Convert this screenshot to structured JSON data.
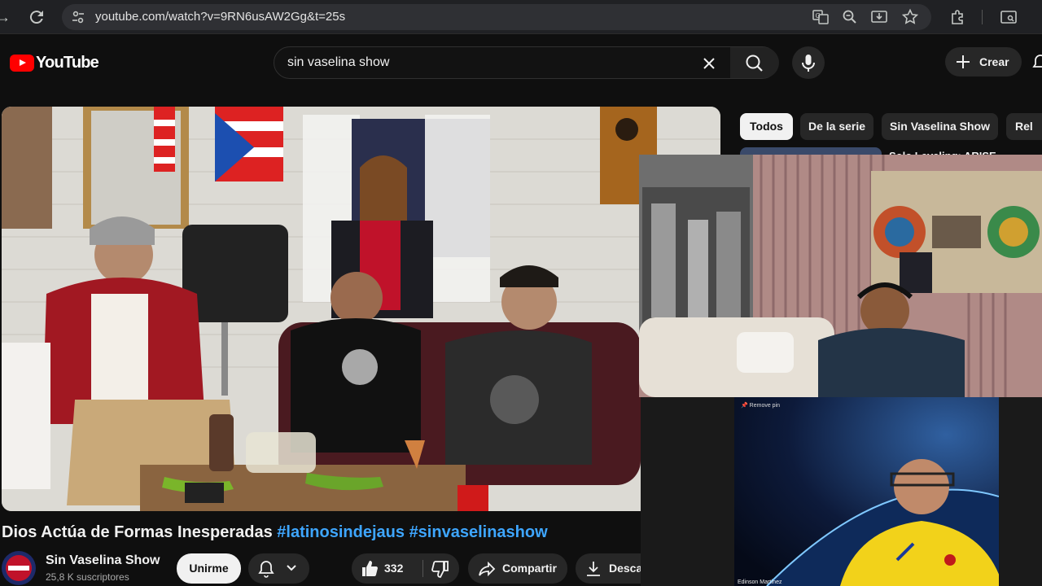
{
  "browser": {
    "url": "youtube.com/watch?v=9RN6usAW2Gg&t=25s"
  },
  "header": {
    "logo_text": "YouTube",
    "search_value": "sin vaselina show",
    "create_label": "Crear"
  },
  "chips": [
    "Todos",
    "De la serie",
    "Sin Vaselina Show",
    "Rel"
  ],
  "video": {
    "title_main": "Dios Actúa de Formas Inesperadas",
    "hashtag1": "#latinosindejaus",
    "hashtag2": "#sinvaselinashow"
  },
  "channel": {
    "name": "Sin Vaselina Show",
    "subscribers": "25,8 K suscriptores",
    "join_label": "Unirme"
  },
  "actions": {
    "likes": "332",
    "share_label": "Compartir",
    "download_label": "Descargar"
  },
  "overlay": {
    "remove_pin": "Remove pin",
    "participant_name": "Edinson Martínez",
    "sidebar_peek": "Solo Leveling: ARISE"
  },
  "colors": {
    "background": "#0f0f0f",
    "brand_red": "#ff0000",
    "hashtag_blue": "#3ea6ff",
    "chip_bg": "#272727"
  }
}
